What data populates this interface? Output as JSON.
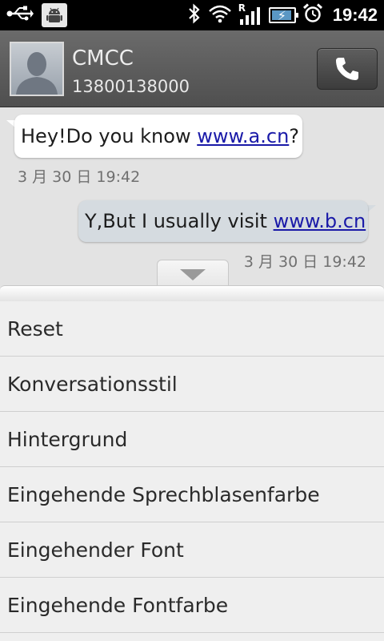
{
  "status_bar": {
    "time": "19:42",
    "icons": [
      "usb-icon",
      "android-debug-icon",
      "bluetooth-icon",
      "wifi-icon",
      "roaming-signal-icon",
      "battery-charging-icon",
      "alarm-icon"
    ],
    "roaming_label": "R"
  },
  "contact": {
    "name": "CMCC",
    "number": "13800138000"
  },
  "messages": [
    {
      "direction": "incoming",
      "text_before": "Hey!Do you know ",
      "link": "www.a.cn",
      "text_after": "?",
      "timestamp": "3 月 30 日 19:42"
    },
    {
      "direction": "outgoing",
      "text_before": "Y,But I usually visit ",
      "link": "www.b.cn",
      "text_after": "",
      "timestamp": "3 月 30 日 19:42"
    }
  ],
  "menu": {
    "items": [
      "Reset",
      "Konversationsstil",
      "Hintergrund",
      "Eingehende Sprechblasenfarbe",
      "Eingehender Font",
      "Eingehende Fontfarbe"
    ]
  },
  "colors": {
    "link": "#1a1aa8",
    "outgoing_bubble": "#d5dbe0",
    "incoming_bubble": "#ffffff",
    "header": "#5a5a5a"
  }
}
